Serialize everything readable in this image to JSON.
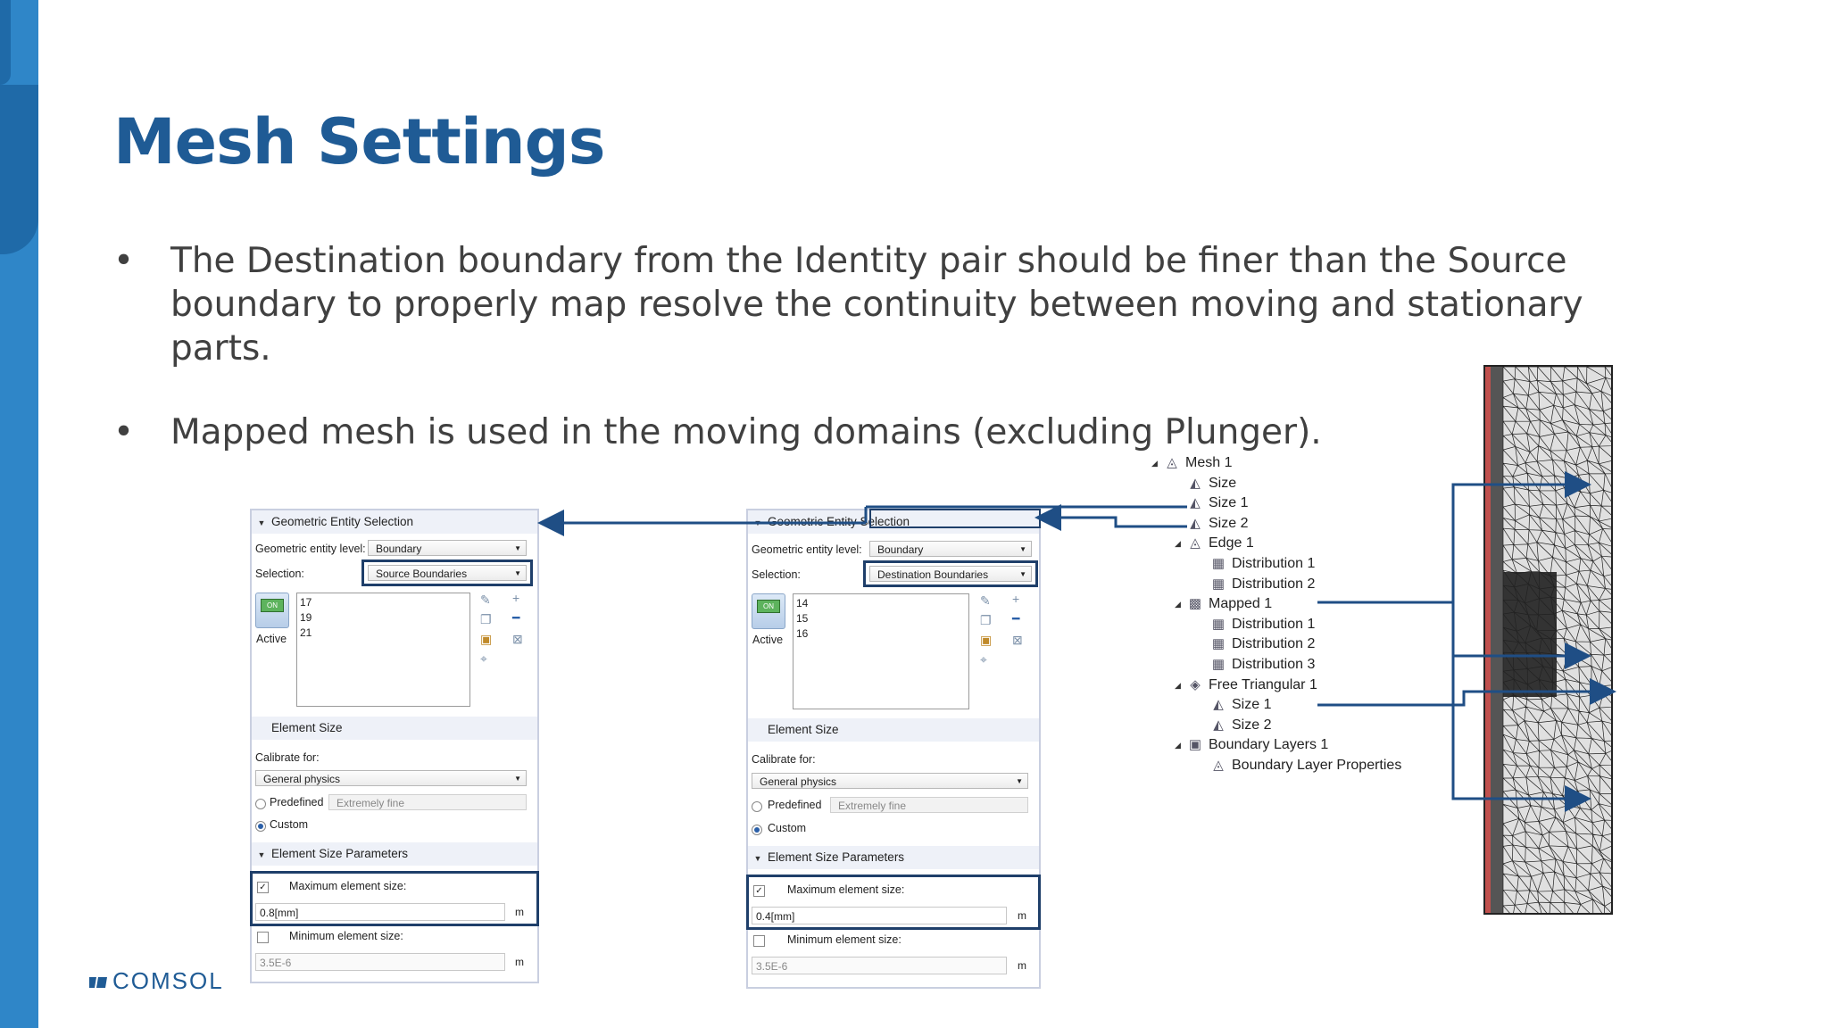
{
  "slide": {
    "title": "Mesh Settings",
    "bullets": [
      {
        "symbol": "•",
        "text": "The Destination boundary from the Identity pair should be finer than the Source boundary to properly map resolve the continuity between moving and stationary parts."
      },
      {
        "symbol": "•",
        "text": "Mapped mesh is used in the moving domains (excluding Plunger)."
      }
    ],
    "logo": "COMSOL"
  },
  "colors": {
    "sidebar": "#2f86c8",
    "title": "#1f5b95",
    "highlight": "#1f3f6a",
    "arrow": "#1f4e85"
  },
  "panels": [
    {
      "geom_section": "Geometric Entity Selection",
      "geom_level_label": "Geometric entity level:",
      "geom_level_value": "Boundary",
      "selection_label": "Selection:",
      "selection_value": "Source Boundaries",
      "list_items": [
        "17",
        "19",
        "21"
      ],
      "active_label": "Active",
      "active_badge": "ON",
      "element_size_section": "Element Size",
      "calibrate_label": "Calibrate for:",
      "calibrate_value": "General physics",
      "predefined_label": "Predefined",
      "predefined_value": "Extremely fine",
      "custom_label": "Custom",
      "params_section": "Element Size Parameters",
      "max_label": "Maximum element size:",
      "max_value": "0.8[mm]",
      "min_label": "Minimum element size:",
      "min_value": "3.5E-6",
      "unit": "m"
    },
    {
      "geom_section": "Geometric Entity Selection",
      "geom_level_label": "Geometric entity level:",
      "geom_level_value": "Boundary",
      "selection_label": "Selection:",
      "selection_value": "Destination Boundaries",
      "list_items": [
        "14",
        "15",
        "16"
      ],
      "active_label": "Active",
      "active_badge": "ON",
      "element_size_section": "Element Size",
      "calibrate_label": "Calibrate for:",
      "calibrate_value": "General physics",
      "predefined_label": "Predefined",
      "predefined_value": "Extremely fine",
      "custom_label": "Custom",
      "params_section": "Element Size Parameters",
      "max_label": "Maximum element size:",
      "max_value": "0.4[mm]",
      "min_label": "Minimum element size:",
      "min_value": "3.5E-6",
      "unit": "m"
    }
  ],
  "tree": [
    {
      "label": "Mesh 1",
      "level": 0,
      "expander": "◢",
      "icon": "mesh-icon"
    },
    {
      "label": "Size",
      "level": 1,
      "expander": "",
      "icon": "size-icon"
    },
    {
      "label": "Size 1",
      "level": 1,
      "expander": "",
      "icon": "size-icon"
    },
    {
      "label": "Size 2",
      "level": 1,
      "expander": "",
      "icon": "size-icon"
    },
    {
      "label": "Edge 1",
      "level": 1,
      "expander": "◢",
      "icon": "edge-icon"
    },
    {
      "label": "Distribution 1",
      "level": 2,
      "expander": "",
      "icon": "distribution-icon"
    },
    {
      "label": "Distribution 2",
      "level": 2,
      "expander": "",
      "icon": "distribution-icon"
    },
    {
      "label": "Mapped 1",
      "level": 1,
      "expander": "◢",
      "icon": "mapped-icon"
    },
    {
      "label": "Distribution 1",
      "level": 2,
      "expander": "",
      "icon": "distribution-icon"
    },
    {
      "label": "Distribution 2",
      "level": 2,
      "expander": "",
      "icon": "distribution-icon"
    },
    {
      "label": "Distribution 3",
      "level": 2,
      "expander": "",
      "icon": "distribution-icon"
    },
    {
      "label": "Free Triangular 1",
      "level": 1,
      "expander": "◢",
      "icon": "free-triangular-icon"
    },
    {
      "label": "Size 1",
      "level": 2,
      "expander": "",
      "icon": "size-icon"
    },
    {
      "label": "Size 2",
      "level": 2,
      "expander": "",
      "icon": "size-icon"
    },
    {
      "label": "Boundary Layers 1",
      "level": 1,
      "expander": "◢",
      "icon": "boundary-layers-icon"
    },
    {
      "label": "Boundary Layer Properties",
      "level": 2,
      "expander": "",
      "icon": "boundary-layer-properties-icon"
    }
  ]
}
